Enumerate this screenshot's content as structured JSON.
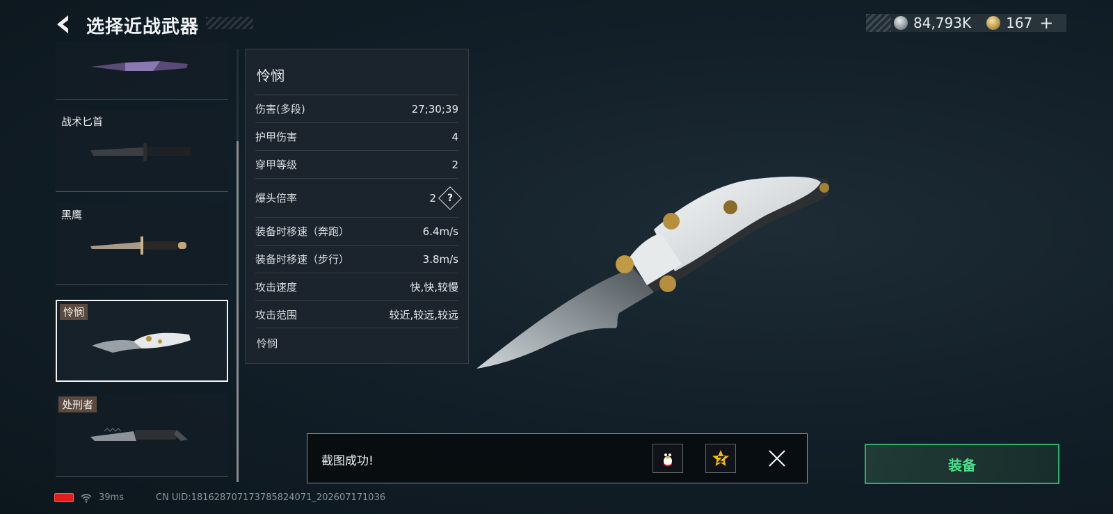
{
  "header": {
    "title": "选择近战武器"
  },
  "currency": {
    "silver_amount": "84,793K",
    "gold_amount": "167",
    "plus_label": "+",
    "silver_icon": "silver-coin-icon",
    "gold_icon": "gold-coin-icon"
  },
  "weapons": [
    {
      "name": "",
      "selected": false
    },
    {
      "name": "战术匕首",
      "selected": false
    },
    {
      "name": "黑鹰",
      "selected": false
    },
    {
      "name": "怜悯",
      "selected": true
    },
    {
      "name": "处刑者",
      "selected": false
    }
  ],
  "stats": {
    "title": "怜悯",
    "rows": [
      {
        "label": "伤害(多段)",
        "value": "27;30;39"
      },
      {
        "label": "护甲伤害",
        "value": "4"
      },
      {
        "label": "穿甲等级",
        "value": "2"
      },
      {
        "label": "爆头倍率",
        "value": "2"
      },
      {
        "label": "装备时移速（奔跑）",
        "value": "6.4m/s"
      },
      {
        "label": "装备时移速（步行）",
        "value": "3.8m/s"
      },
      {
        "label": "攻击速度",
        "value": "快,快,较慢"
      },
      {
        "label": "攻击范围",
        "value": "较近,较远,较远"
      }
    ],
    "help_label": "?",
    "footer": "怜悯"
  },
  "toast": {
    "text": "截图成功!"
  },
  "equip_label": "装备",
  "status": {
    "latency": "39ms",
    "uid": "CN UID:1816287071737858240​71_202607171036"
  },
  "colors": {
    "accent_green": "#2fb06f",
    "battery_red": "#e01d1d"
  }
}
